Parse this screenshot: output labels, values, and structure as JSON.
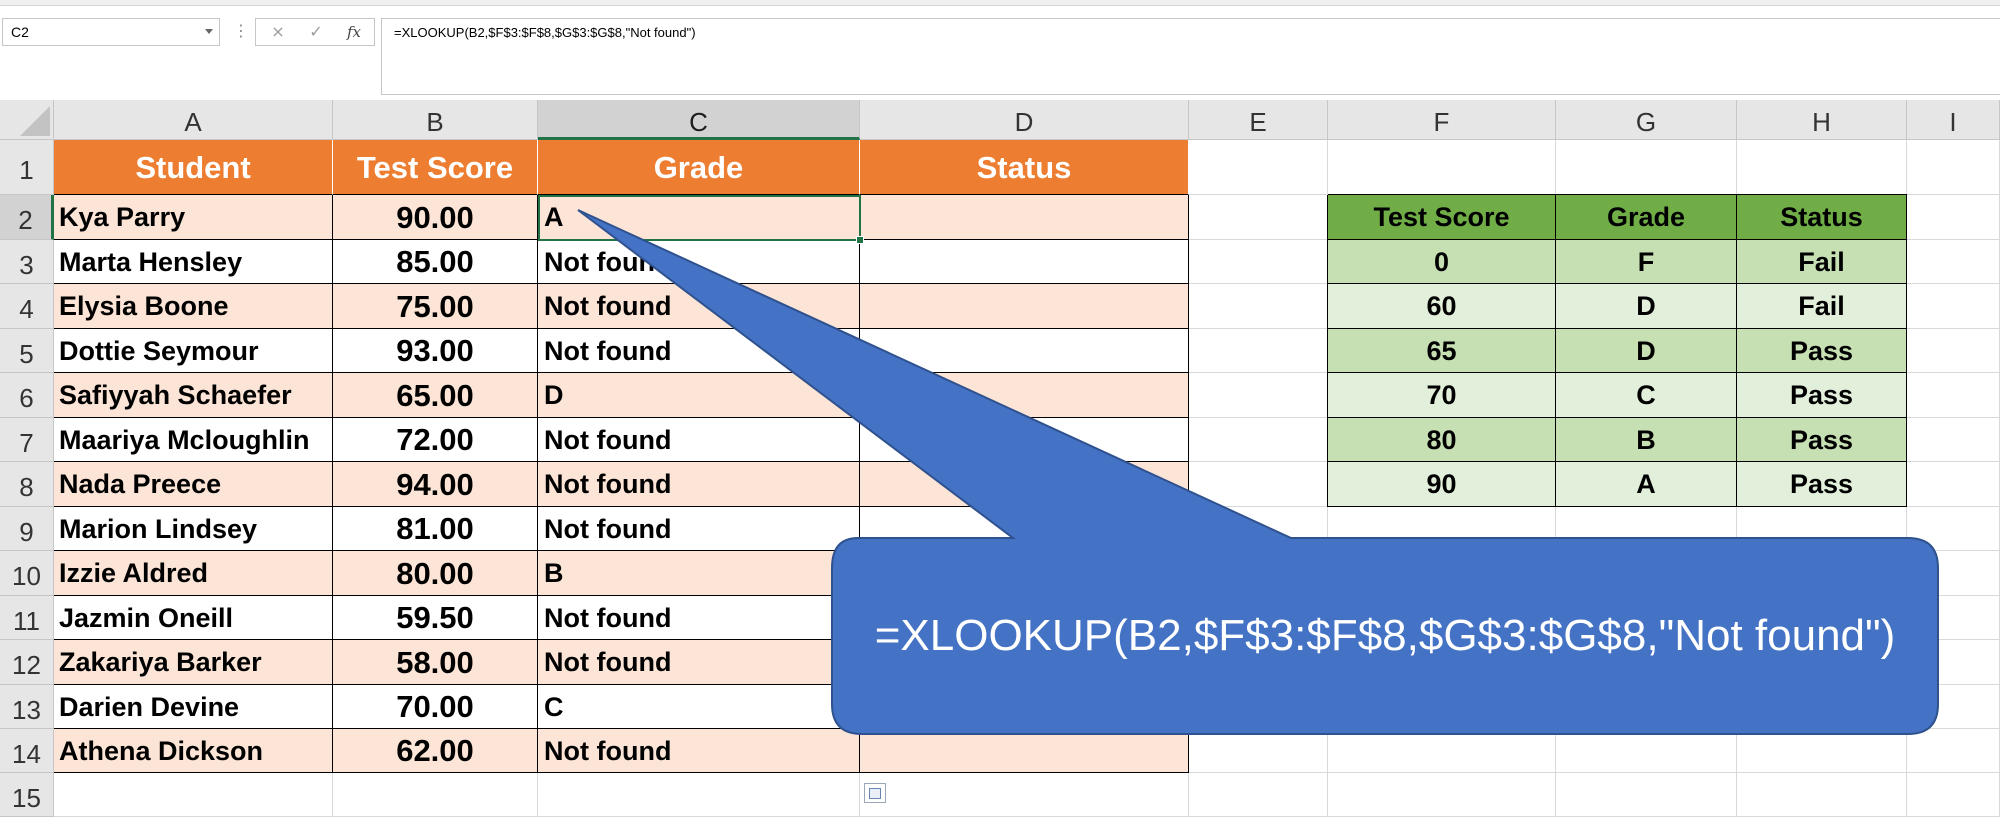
{
  "namebox": {
    "value": "C2"
  },
  "formula_bar": {
    "cancel_icon": "×",
    "enter_icon": "✓",
    "fx_label": "fx",
    "formula": "=XLOOKUP(B2,$F$3:$F$8,$G$3:$G$8,\"Not found\")"
  },
  "columns": [
    "A",
    "B",
    "C",
    "D",
    "E",
    "F",
    "G",
    "H",
    "I"
  ],
  "rows": [
    "1",
    "2",
    "3",
    "4",
    "5",
    "6",
    "7",
    "8",
    "9",
    "10",
    "11",
    "12",
    "13",
    "14",
    "15"
  ],
  "headers": {
    "student": "Student",
    "test_score": "Test Score",
    "grade": "Grade",
    "status": "Status"
  },
  "students": [
    {
      "name": "Kya Parry",
      "score": "90.00",
      "grade": "A"
    },
    {
      "name": "Marta Hensley",
      "score": "85.00",
      "grade": "Not found"
    },
    {
      "name": "Elysia Boone",
      "score": "75.00",
      "grade": "Not found"
    },
    {
      "name": "Dottie Seymour",
      "score": "93.00",
      "grade": "Not found"
    },
    {
      "name": "Safiyyah Schaefer",
      "score": "65.00",
      "grade": "D"
    },
    {
      "name": "Maariya Mcloughlin",
      "score": "72.00",
      "grade": "Not found"
    },
    {
      "name": "Nada Preece",
      "score": "94.00",
      "grade": "Not found"
    },
    {
      "name": "Marion Lindsey",
      "score": "81.00",
      "grade": "Not found"
    },
    {
      "name": "Izzie Aldred",
      "score": "80.00",
      "grade": "B"
    },
    {
      "name": "Jazmin Oneill",
      "score": "59.50",
      "grade": "Not found"
    },
    {
      "name": "Zakariya Barker",
      "score": "58.00",
      "grade": "Not found"
    },
    {
      "name": "Darien Devine",
      "score": "70.00",
      "grade": "C"
    },
    {
      "name": "Athena Dickson",
      "score": "62.00",
      "grade": "Not found"
    }
  ],
  "lookup_headers": {
    "test_score": "Test Score",
    "grade": "Grade",
    "status": "Status"
  },
  "lookup": [
    {
      "score": "0",
      "grade": "F",
      "status": "Fail"
    },
    {
      "score": "60",
      "grade": "D",
      "status": "Fail"
    },
    {
      "score": "65",
      "grade": "D",
      "status": "Pass"
    },
    {
      "score": "70",
      "grade": "C",
      "status": "Pass"
    },
    {
      "score": "80",
      "grade": "B",
      "status": "Pass"
    },
    {
      "score": "90",
      "grade": "A",
      "status": "Pass"
    }
  ],
  "callout": {
    "text": "=XLOOKUP(B2,$F$3:$F$8,$G$3:$G$8,\"Not found\")"
  },
  "colors": {
    "header_orange": "#ed7d31",
    "band_peach": "#fce4d6",
    "lookup_header_green": "#70ad47",
    "lookup_band_green": "#c6e0b4",
    "lookup_band_light": "#e2efda",
    "callout_blue": "#4472c4",
    "selection_green": "#217346"
  }
}
